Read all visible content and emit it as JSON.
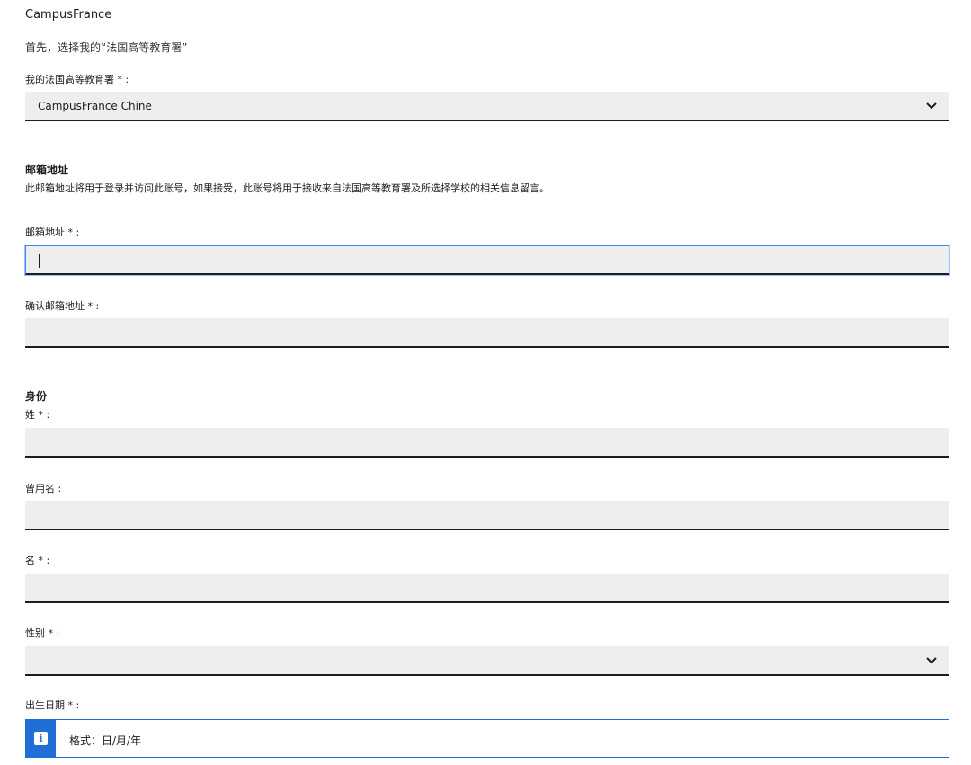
{
  "brand": "CampusFrance",
  "intro": "首先，选择我的“法国高等教育署”",
  "agency": {
    "label": "我的法国高等教育署 * :",
    "selected": "CampusFrance Chine",
    "icon": "chevron-down-icon"
  },
  "email_section": {
    "title": "邮箱地址",
    "description": "此邮箱地址将用于登录并访问此账号，如果接受，此账号将用于接收来自法国高等教育署及所选择学校的相关信息留言。",
    "email_label": "邮箱地址 * :",
    "email_value": "",
    "confirm_label": "确认邮箱地址 * :",
    "confirm_value": ""
  },
  "identity_section": {
    "title": "身份",
    "last_name_label": "姓 * :",
    "common_name_label": "曾用名 :",
    "first_name_label": "名 * :",
    "gender_label": "性别 * :",
    "gender_selected": "",
    "birthdate_label": "出生日期 * :",
    "birthdate_hint": "格式：日/月/年",
    "info_icon": "info-icon"
  },
  "colors": {
    "field_bg": "#eeeeee",
    "underline": "#1e1e1e",
    "focus": "#3a86ff",
    "info_blue": "#1f6fd6"
  }
}
